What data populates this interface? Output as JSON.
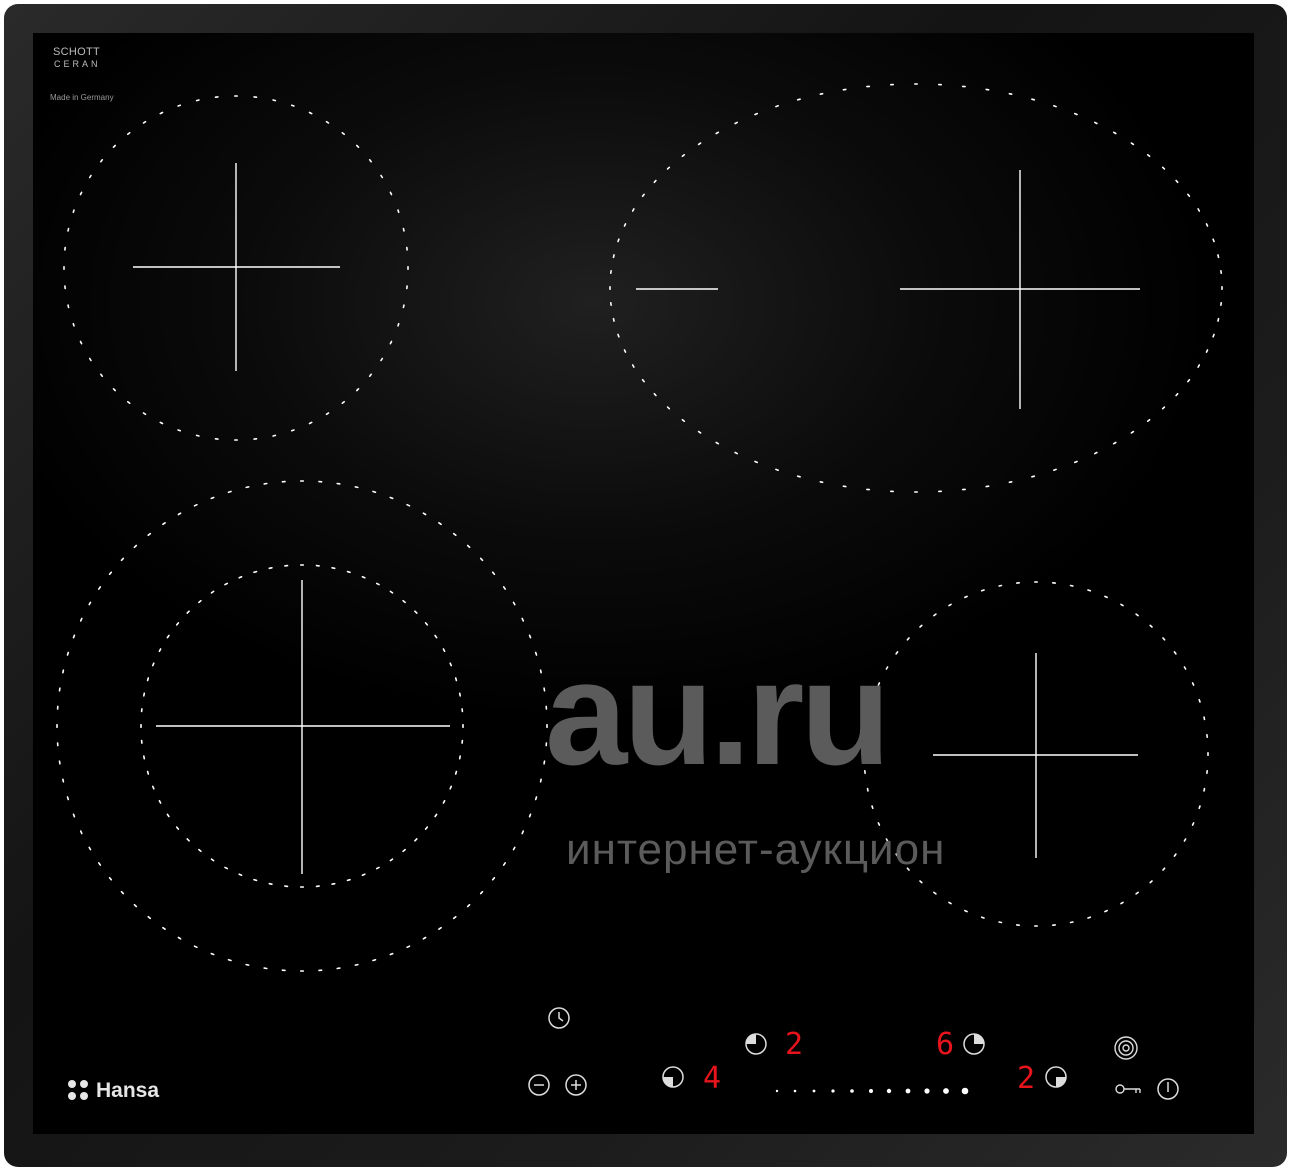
{
  "branding": {
    "glass_brand_line1": "SCHOTT",
    "glass_brand_line2": "CERAN",
    "origin": "Made in Germany",
    "maker": "Hansa"
  },
  "watermark": {
    "main": "au.ru",
    "sub": "интернет-аукцион"
  },
  "displays": {
    "zone_rear_left": "2",
    "zone_front_left": "4",
    "zone_rear_right": "6",
    "zone_front_right": "2"
  },
  "icons": [
    "clock-icon",
    "minus-icon",
    "plus-icon",
    "zone-indicator-icon",
    "booster-icon",
    "key-lock-icon",
    "power-icon"
  ],
  "colors": {
    "glass": "#000000",
    "frame": "#1e1e1e",
    "zone_markings": "#ffffff",
    "display_led": "#e8141b",
    "watermark": "#5b5b5b"
  }
}
